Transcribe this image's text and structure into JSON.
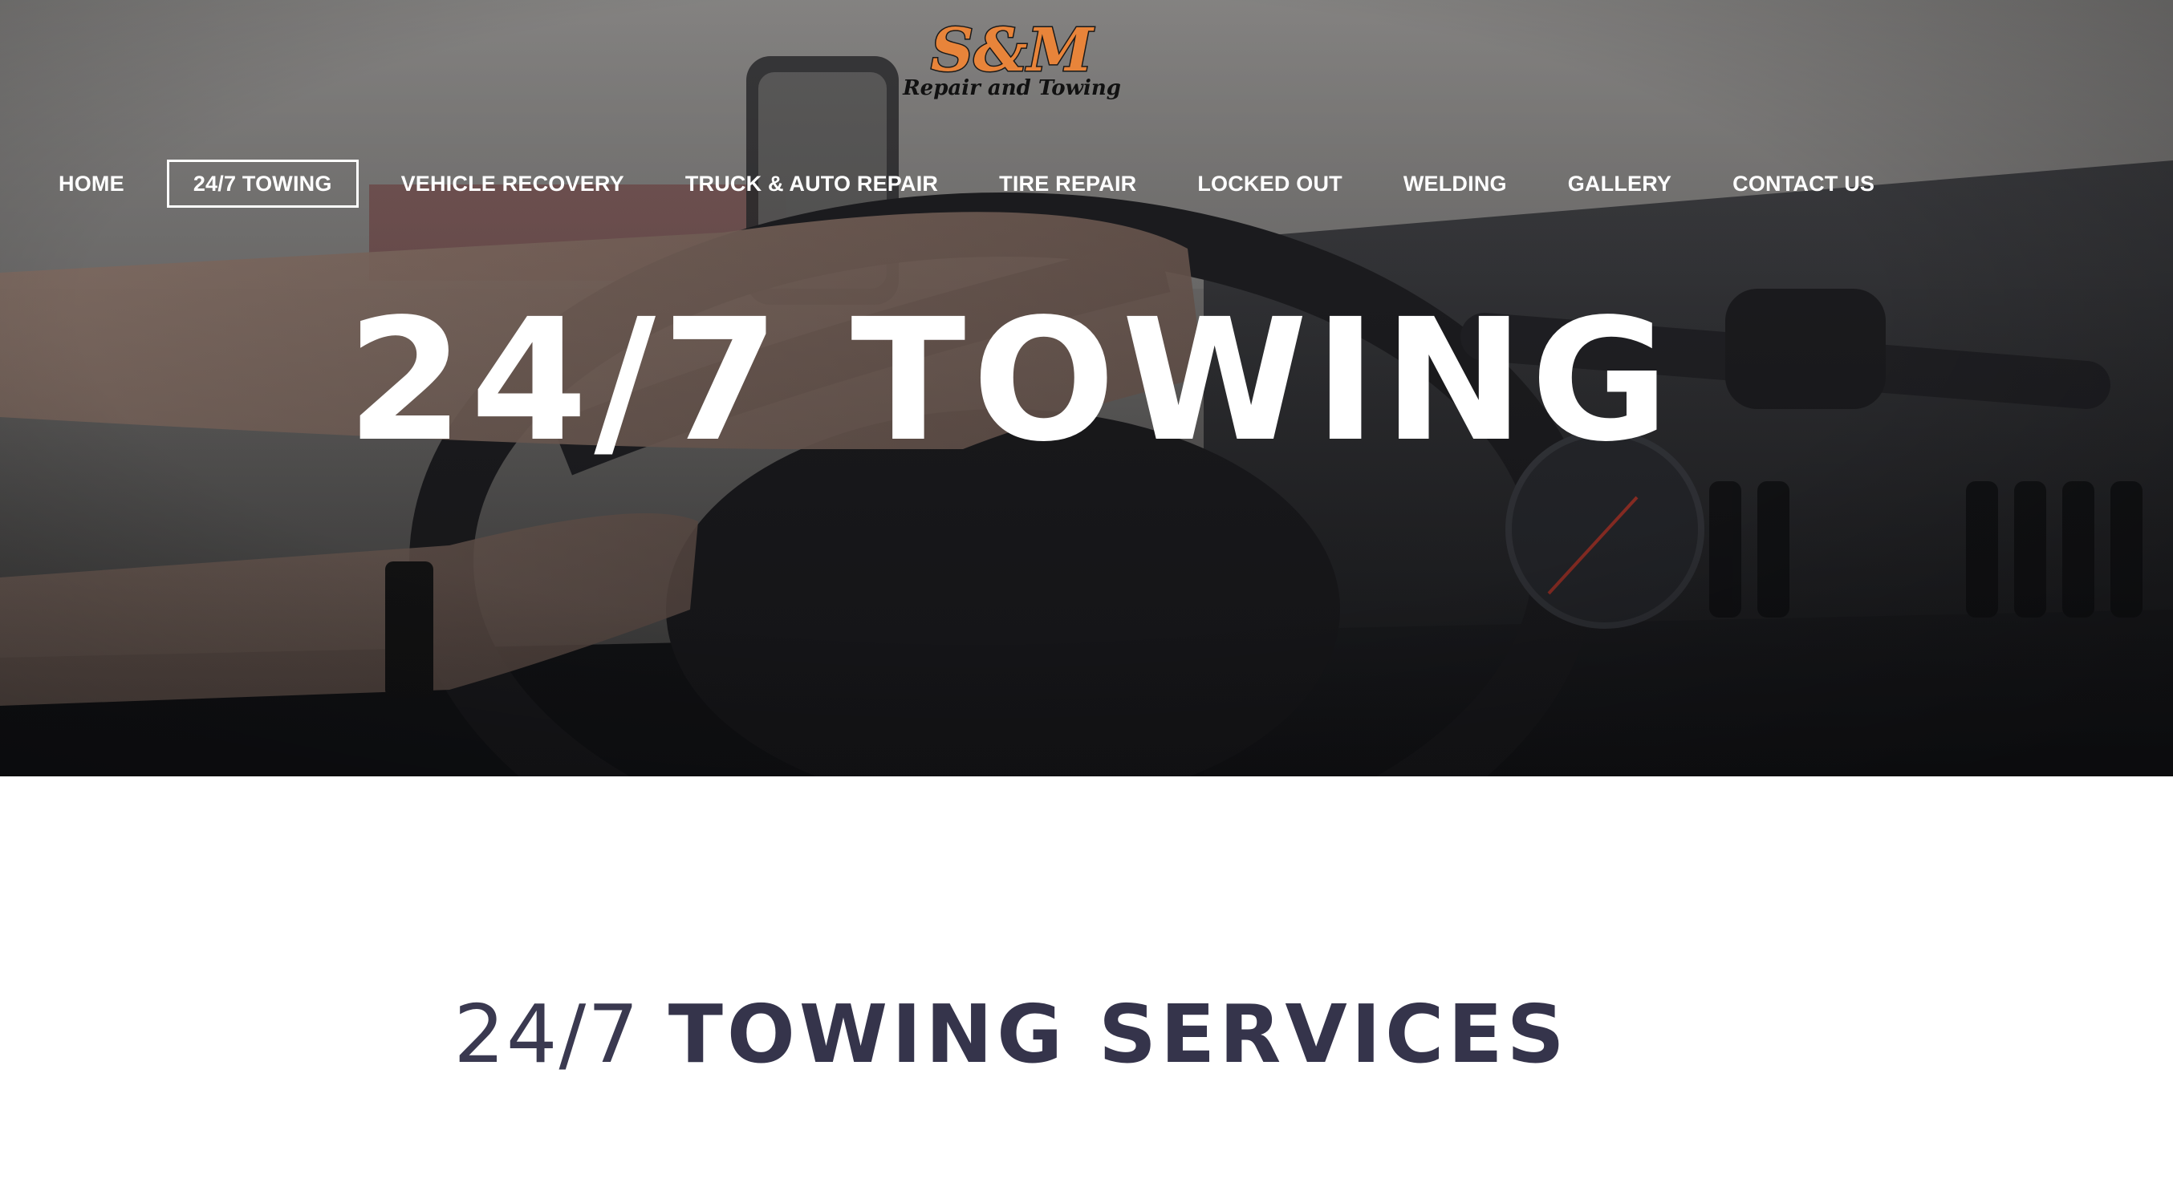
{
  "brand": {
    "logo_main": "S&M",
    "logo_tagline": "Repair and Towing"
  },
  "nav": {
    "items": [
      {
        "label": "HOME"
      },
      {
        "label": "24/7 TOWING",
        "active": true
      },
      {
        "label": "VEHICLE RECOVERY"
      },
      {
        "label": "TRUCK & AUTO REPAIR"
      },
      {
        "label": "TIRE REPAIR"
      },
      {
        "label": "LOCKED OUT"
      },
      {
        "label": "WELDING"
      },
      {
        "label": "GALLERY"
      },
      {
        "label": "CONTACT US"
      }
    ]
  },
  "hero": {
    "title": "24/7 TOWING",
    "background": "photo of hands on a truck steering wheel, dark overlay"
  },
  "section": {
    "heading_light": "24/7",
    "heading_bold": "TOWING SERVICES"
  },
  "colors": {
    "logo_orange": "#e8843a",
    "heading_navy": "#35344b",
    "nav_text": "#ffffff"
  }
}
